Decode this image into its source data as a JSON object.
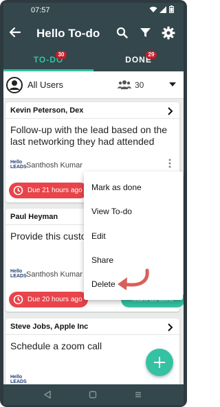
{
  "status_bar": {
    "time": "07:57"
  },
  "app_bar": {
    "title": "Hello To-do"
  },
  "tabs": [
    {
      "label": "TO-DO",
      "badge": "30",
      "active": true
    },
    {
      "label": "DONE",
      "badge": "29",
      "active": false
    }
  ],
  "user_filter": {
    "label": "All Users",
    "count": "30"
  },
  "cards": [
    {
      "contact": "Kevin Peterson, Dex",
      "text": "Follow-up with the lead based on the last networking they had attended",
      "owner": "Santhosh Kumar",
      "due": "Due 21 hours ago"
    },
    {
      "contact": "Paul Heyman",
      "text": "Provide this custom product document",
      "owner": "Santhosh Kumar",
      "due": "Due 20 hours ago",
      "action": "Mark as done"
    },
    {
      "contact": "Steve Jobs, Apple Inc",
      "text": "Schedule a zoom call",
      "owner": ""
    }
  ],
  "logo": {
    "line1": "Hello",
    "line2": "LEADS"
  },
  "menu": {
    "items": [
      "Mark as done",
      "View To-do",
      "Edit",
      "Share",
      "Delete"
    ]
  },
  "colors": {
    "appbar": "#33474c",
    "accent": "#35c2a3",
    "due": "#e8444a",
    "badge": "#c0202a",
    "arrow": "#d9605a"
  }
}
